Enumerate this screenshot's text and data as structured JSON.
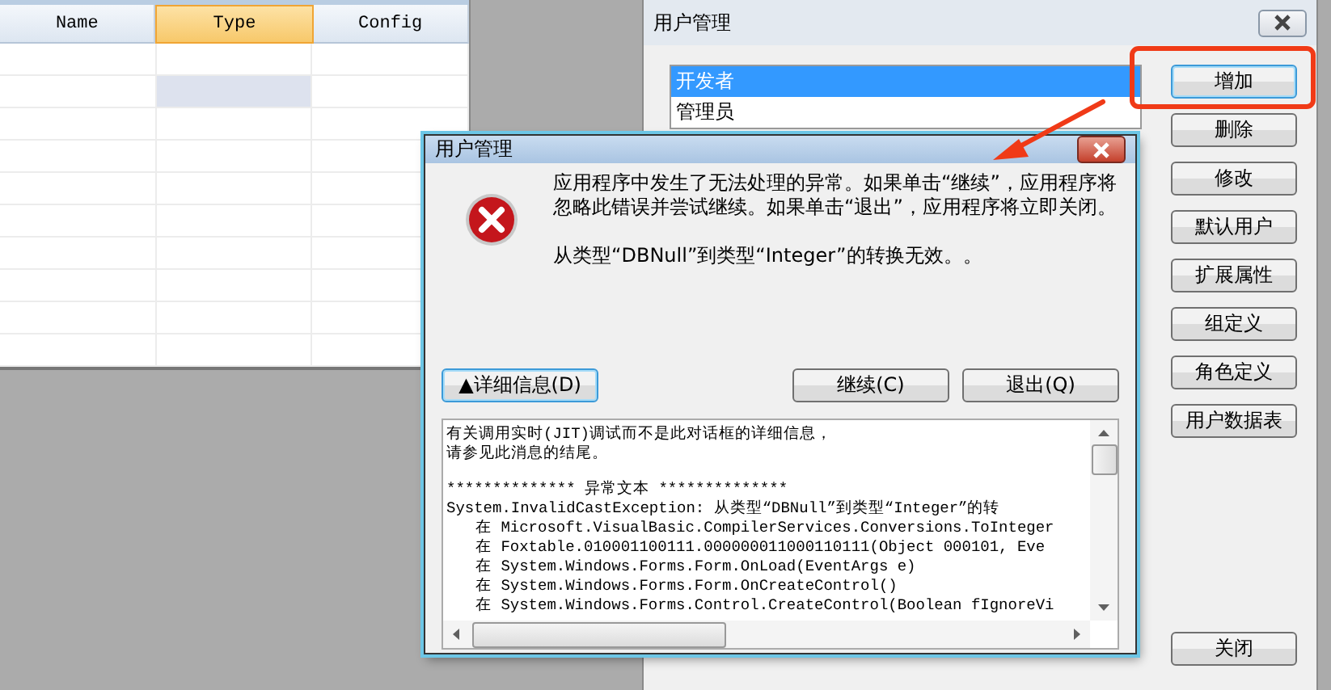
{
  "grid": {
    "columns": [
      {
        "label": "Name",
        "selected": false
      },
      {
        "label": "Type",
        "selected": true
      },
      {
        "label": "Config",
        "selected": false
      }
    ],
    "rows": [
      {
        "selected": false
      },
      {
        "selected": true
      },
      {
        "selected": false
      },
      {
        "selected": false
      },
      {
        "selected": false
      },
      {
        "selected": false
      },
      {
        "selected": false
      },
      {
        "selected": false
      },
      {
        "selected": false
      },
      {
        "selected": false
      }
    ]
  },
  "user_window": {
    "title": "用户管理",
    "users": [
      {
        "label": "开发者",
        "selected": true
      },
      {
        "label": "管理员",
        "selected": false
      }
    ],
    "buttons": [
      "增加",
      "删除",
      "修改",
      "默认用户",
      "扩展属性",
      "组定义",
      "角色定义",
      "用户数据表"
    ],
    "close_button": "关闭"
  },
  "error_dialog": {
    "title": "用户管理",
    "message": "应用程序中发生了无法处理的异常。如果单击“继续”，应用程序将忽略此错误并尝试继续。如果单击“退出”，应用程序将立即关闭。",
    "detail_message": "从类型“DBNull”到类型“Integer”的转换无效。。",
    "details_button": "▲详细信息(D)",
    "buttons": [
      "继续(C)",
      "退出(Q)"
    ],
    "details": [
      {
        "text": "有关调用实时(JIT)调试而不是此对话框的详细信息，",
        "indent": false
      },
      {
        "text": "请参见此消息的结尾。",
        "indent": false
      },
      {
        "text": "************** 异常文本 **************",
        "indent": false
      },
      {
        "text": "System.InvalidCastException: 从类型“DBNull”到类型“Integer”的转",
        "indent": false
      },
      {
        "text": "在 Microsoft.VisualBasic.CompilerServices.Conversions.ToInteger",
        "indent": true
      },
      {
        "text": "在 Foxtable.010001100111.000000011000110111(Object 000101, Eve",
        "indent": true
      },
      {
        "text": "在 System.Windows.Forms.Form.OnLoad(EventArgs e)",
        "indent": true
      },
      {
        "text": "在 System.Windows.Forms.Form.OnCreateControl()",
        "indent": true
      },
      {
        "text": "在 System.Windows.Forms.Control.CreateControl(Boolean fIgnoreVi",
        "indent": true
      }
    ]
  }
}
